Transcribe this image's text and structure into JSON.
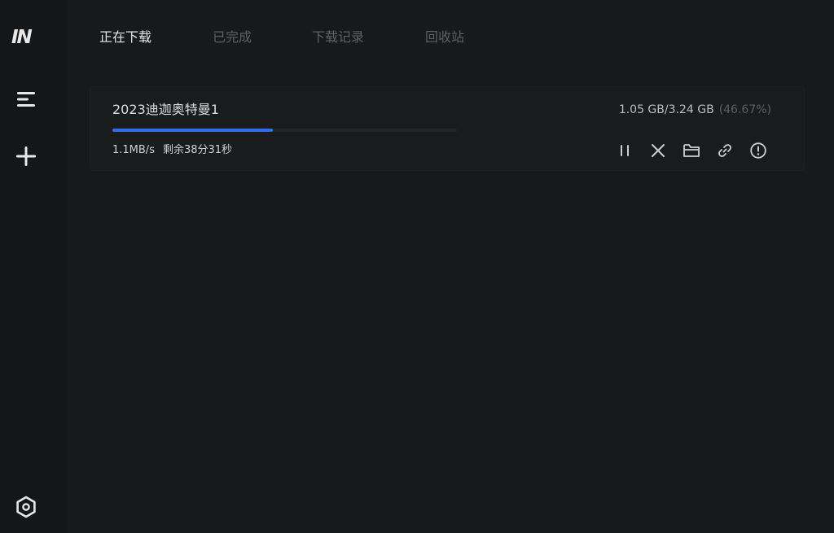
{
  "app": {
    "logo_text": "IN"
  },
  "sidebar": {
    "items": [
      {
        "icon": "menu-icon"
      },
      {
        "icon": "plus-icon"
      },
      {
        "icon": "settings-hexagon-icon"
      }
    ]
  },
  "tabs": [
    {
      "label": "正在下载",
      "active": true
    },
    {
      "label": "已完成",
      "active": false
    },
    {
      "label": "下载记录",
      "active": false
    },
    {
      "label": "回收站",
      "active": false
    }
  ],
  "downloads": [
    {
      "name": "2023迪迦奥特曼1",
      "size_text": "1.05 GB/3.24 GB",
      "percent_text": "(46.67%)",
      "progress": 0.4667,
      "speed": "1.1MB/s",
      "remaining": "剩余38分31秒",
      "actions": [
        "pause-icon",
        "close-icon",
        "folder-icon",
        "link-icon",
        "info-icon"
      ]
    }
  ],
  "colors": {
    "accent": "#2e6ff0",
    "background": "#18191b",
    "sidebar": "#151618",
    "card": "#1a1b1d",
    "text_primary": "#dcdcdc",
    "text_muted": "#5f6064"
  }
}
